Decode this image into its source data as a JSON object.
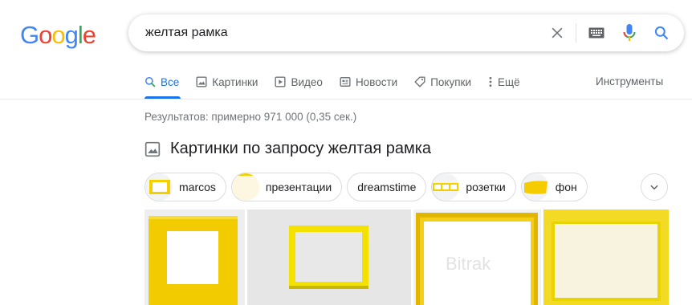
{
  "logo": {
    "letters": [
      "G",
      "o",
      "o",
      "g",
      "l",
      "e"
    ],
    "colors": [
      "#4285f4",
      "#ea4335",
      "#fbbc05",
      "#4285f4",
      "#34a853",
      "#ea4335"
    ]
  },
  "search": {
    "query": "желтая рамка",
    "icons": [
      "close-icon",
      "keyboard-icon",
      "microphone-icon",
      "search-icon"
    ]
  },
  "tabs": [
    {
      "label": "Все",
      "icon": "search-icon",
      "active": true
    },
    {
      "label": "Картинки",
      "icon": "image-icon"
    },
    {
      "label": "Видео",
      "icon": "video-icon"
    },
    {
      "label": "Новости",
      "icon": "news-icon"
    },
    {
      "label": "Покупки",
      "icon": "tag-icon"
    },
    {
      "label": "Ещё",
      "icon": "more-icon"
    }
  ],
  "tools_label": "Инструменты",
  "result_stats": "Результатов: примерно 971 000 (0,35 сек.)",
  "images_section": {
    "title": "Картинки по запросу желтая рамка"
  },
  "chips": [
    {
      "label": "marcos"
    },
    {
      "label": "презентации"
    },
    {
      "label": "dreamstime"
    },
    {
      "label": "розетки"
    },
    {
      "label": "фон"
    }
  ],
  "colors": {
    "accent": "#1a73e8",
    "frame_yellow": "#f5d000"
  }
}
